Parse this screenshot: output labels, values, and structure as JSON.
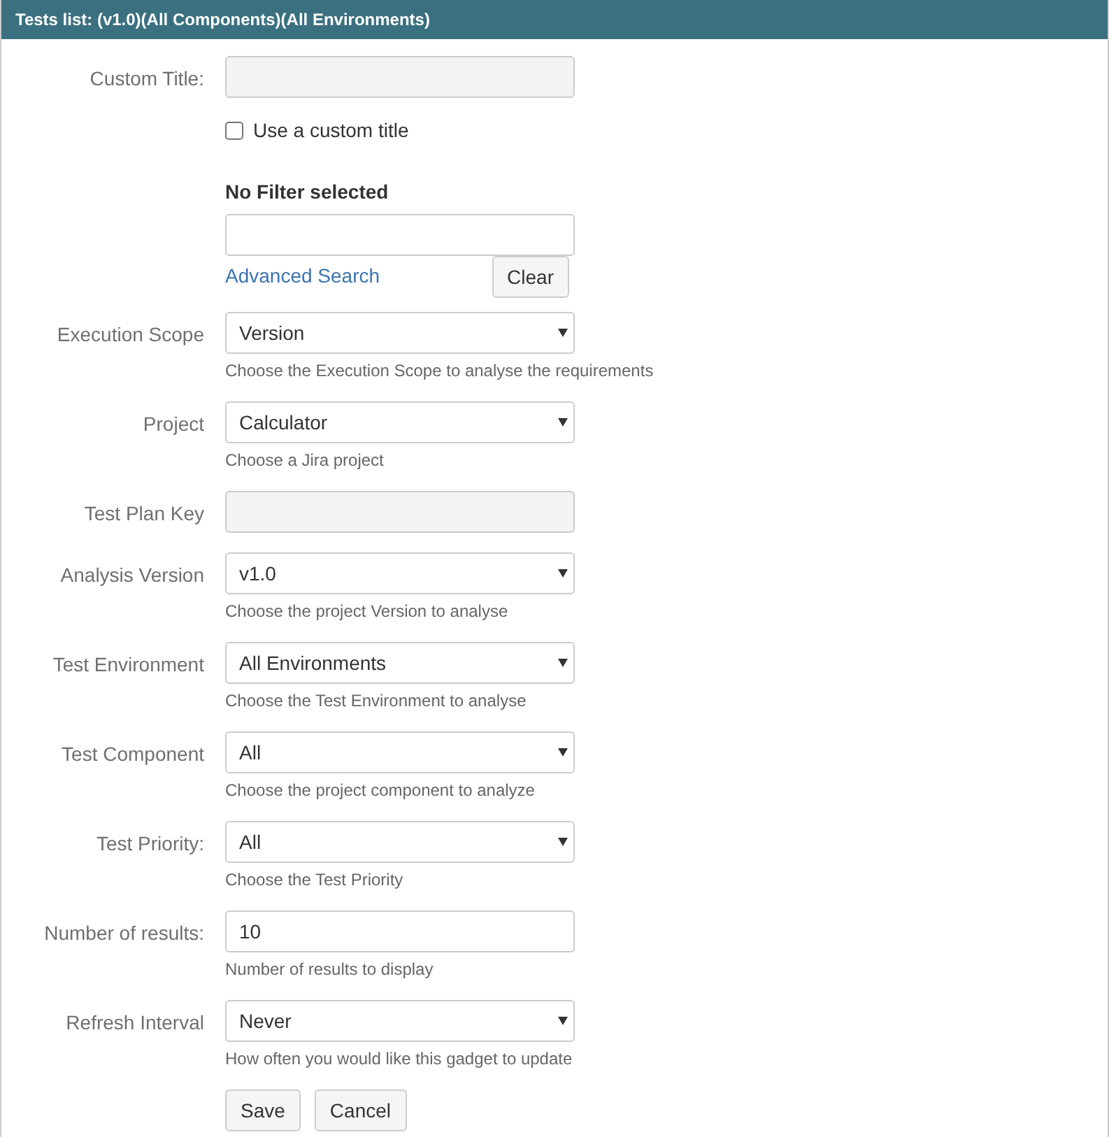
{
  "header": {
    "title": "Tests list: (v1.0)(All Components)(All Environments)"
  },
  "fields": [
    {
      "kind": "text",
      "label": "Custom Title:",
      "disabled": true
    },
    {
      "kind": "checkbox",
      "label": "Use a custom title",
      "checked": false
    },
    {
      "kind": "filter",
      "heading": "No Filter selected",
      "link": "Advanced Search",
      "button": "Clear"
    },
    {
      "kind": "select",
      "label": "Execution Scope",
      "value": "Version",
      "help": "Choose the Execution Scope to analyse the requirements"
    },
    {
      "kind": "select",
      "label": "Project",
      "value": "Calculator",
      "help": "Choose a Jira project"
    },
    {
      "kind": "text",
      "label": "Test Plan Key",
      "disabled": true
    },
    {
      "kind": "select",
      "label": "Analysis Version",
      "value": "v1.0",
      "help": "Choose the project Version to analyse"
    },
    {
      "kind": "select",
      "label": "Test Environment",
      "value": "All Environments",
      "help": "Choose the Test Environment to analyse"
    },
    {
      "kind": "select",
      "label": "Test Component",
      "value": "All",
      "help": "Choose the project component to analyze"
    },
    {
      "kind": "select",
      "label": "Test Priority:",
      "value": "All",
      "help": "Choose the Test Priority"
    },
    {
      "kind": "text",
      "label": "Number of results:",
      "value": "10",
      "disabled": false,
      "help": "Number of results to display"
    },
    {
      "kind": "select",
      "label": "Refresh Interval",
      "value": "Never",
      "help": "How often you would like this gadget to update"
    }
  ],
  "buttons": [
    "Save",
    "Cancel"
  ]
}
